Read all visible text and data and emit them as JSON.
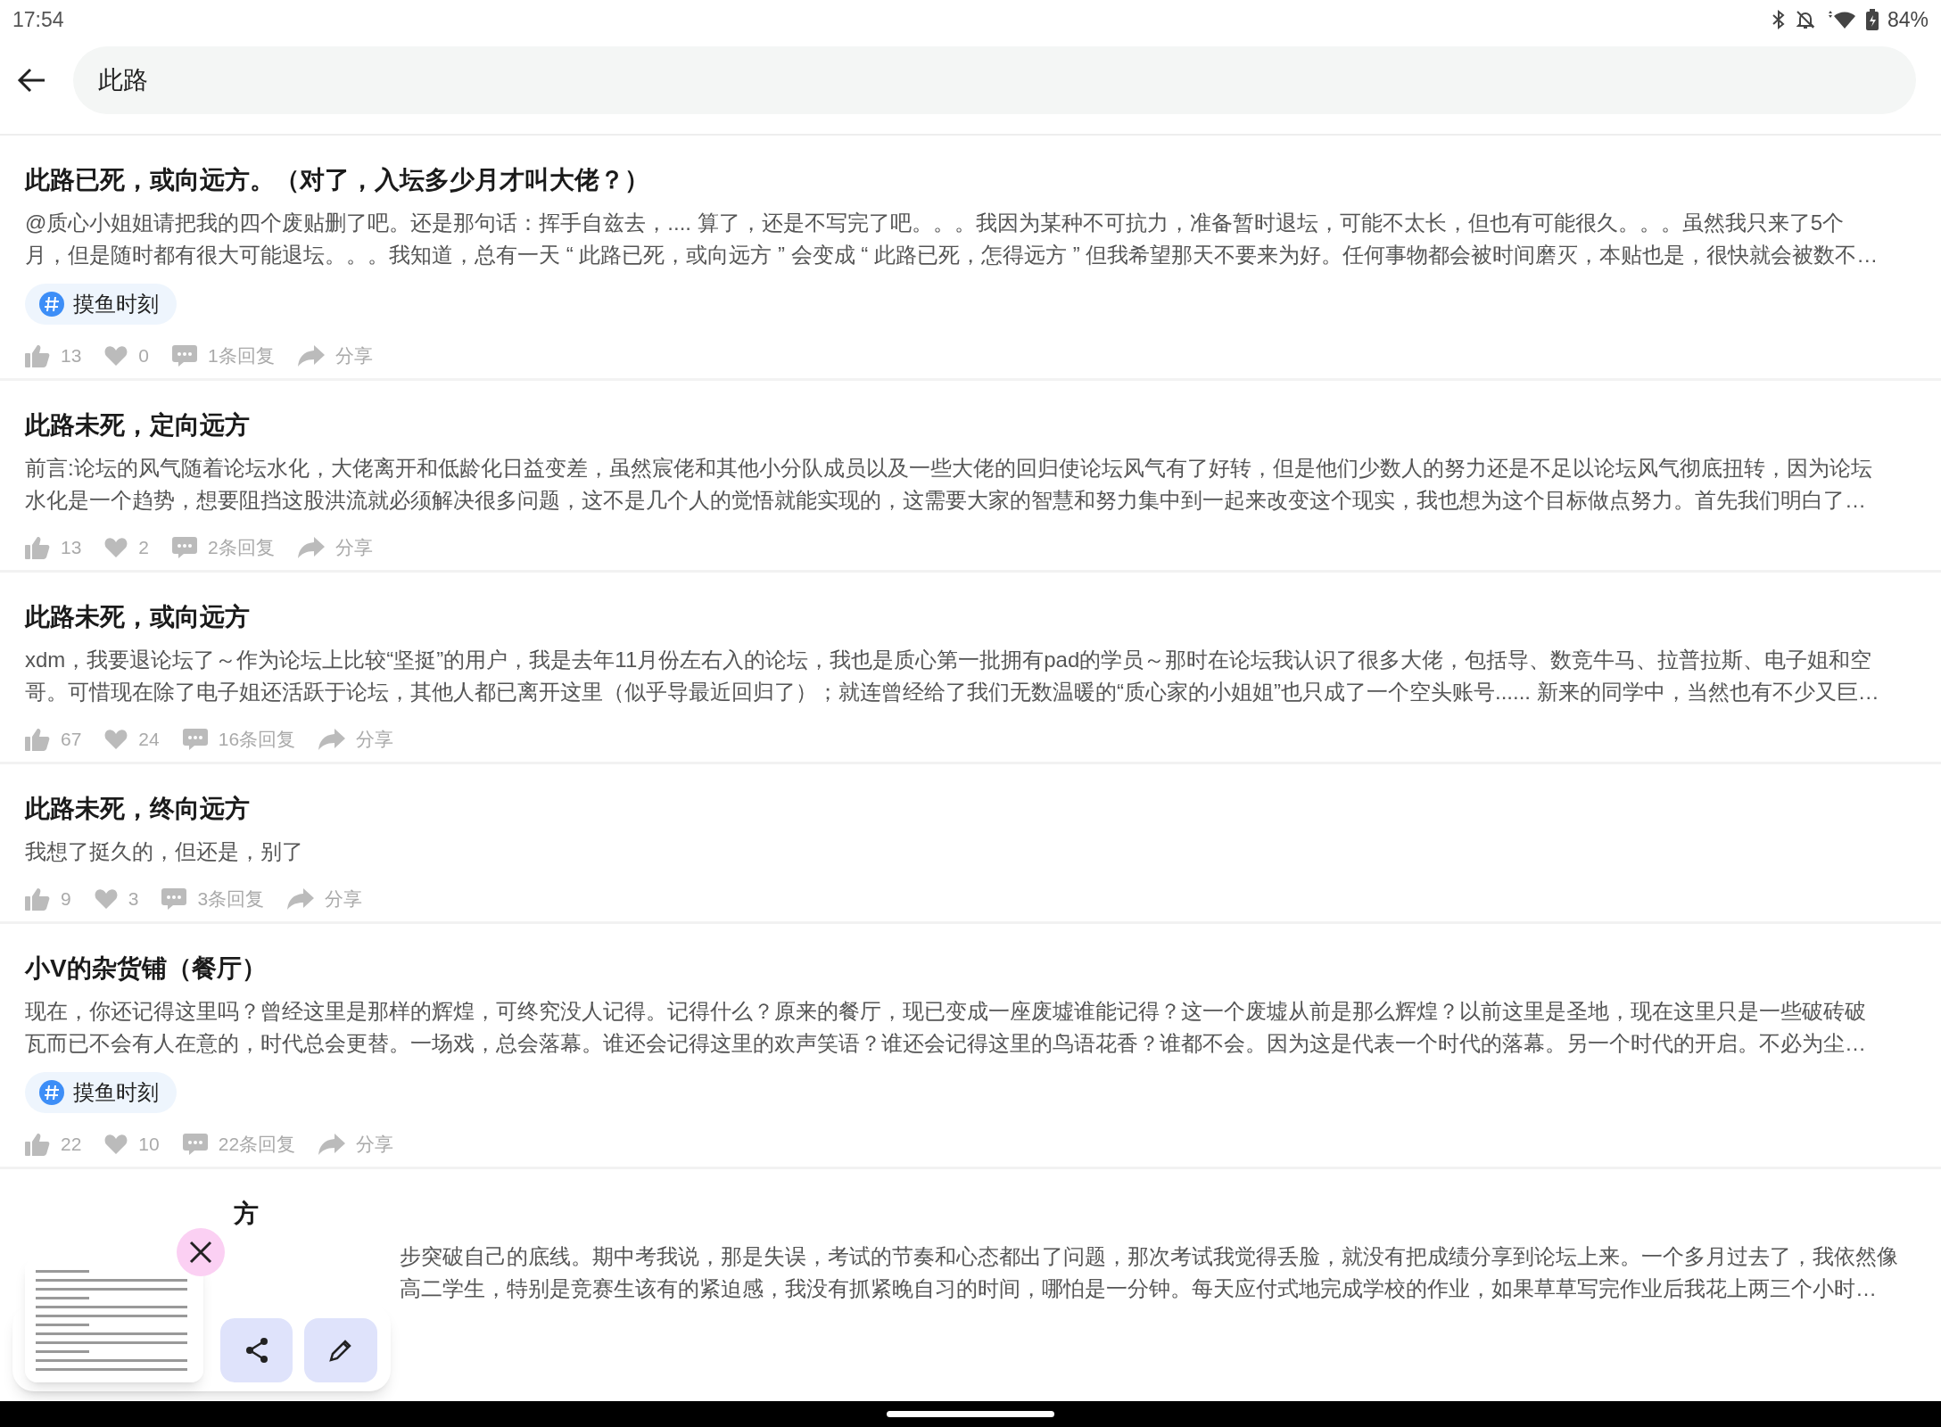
{
  "status_bar": {
    "time": "17:54",
    "battery": "84%"
  },
  "search": {
    "value": "此路"
  },
  "posts": [
    {
      "title": "此路已死，或向远方。（对了，入坛多少月才叫大佬？）",
      "lines": [
        "@质心小姐姐请把我的四个废贴删了吧。还是那句话：挥手自兹去，....  算了，还是不写完了吧。。。我因为某种不可抗力，准备暂时退坛，可能不太长，但也有可能很久。。。虽然我只来了5个",
        "月，但是随时都有很大可能退坛。。。我知道，总有一天 “ 此路已死，或向远方 ” 会变成 “ 此路已死，怎得远方 ” 但我希望那天不要来为好。任何事物都会被时间磨灭，本贴也是，很快就会被数不…"
      ],
      "tag": "摸鱼时刻",
      "likes": "13",
      "hearts": "0",
      "replies": "1条回复",
      "share": "分享"
    },
    {
      "title": "此路未死，定向远方",
      "lines": [
        "前言:论坛的风气随着论坛水化，大佬离开和低龄化日益变差，虽然宸佬和其他小分队成员以及一些大佬的回归使论坛风气有了好转，但是他们少数人的努力还是不足以论坛风气彻底扭转，因为论坛",
        "水化是一个趋势，想要阻挡这股洪流就必须解决很多问题，这不是几个人的觉悟就能实现的，这需要大家的智慧和努力集中到一起来改变这个现实，我也想为这个目标做点努力。首先我们明白了…"
      ],
      "likes": "13",
      "hearts": "2",
      "replies": "2条回复",
      "share": "分享"
    },
    {
      "title": "此路未死，或向远方",
      "lines": [
        "xdm，我要退论坛了～作为论坛上比较“坚挺”的用户，我是去年11月份左右入的论坛，我也是质心第一批拥有pad的学员～那时在论坛我认识了很多大佬，包括导、数竞牛马、拉普拉斯、电子姐和空",
        "哥。可惜现在除了电子姐还活跃于论坛，其他人都已离开这里（似乎导最近回归了）；就连曾经给了我们无数温暖的“质心家的小姐姐”也只成了一个空头账号...... 新来的同学中，当然也有不少又巨…"
      ],
      "likes": "67",
      "hearts": "24",
      "replies": "16条回复",
      "share": "分享"
    },
    {
      "title": "此路未死，终向远方",
      "lines": [
        "我想了挺久的，但还是，别了"
      ],
      "likes": "9",
      "hearts": "3",
      "replies": "3条回复",
      "share": "分享"
    },
    {
      "title": "小V的杂货铺（餐厅）",
      "lines": [
        "现在，你还记得这里吗？曾经这里是那样的辉煌，可终究没人记得。记得什么？原来的餐厅，现已变成一座废墟谁能记得？这一个废墟从前是那么辉煌？以前这里是圣地，现在这里只是一些破砖破",
        "瓦而已不会有人在意的，时代总会更替。一场戏，总会落幕。谁还会记得这里的欢声笑语？谁还会记得这里的鸟语花香？谁都不会。因为这是代表一个时代的落幕。另一个时代的开启。不必为尘…"
      ],
      "tag": "摸鱼时刻",
      "likes": "22",
      "hearts": "10",
      "replies": "22条回复",
      "share": "分享"
    }
  ],
  "partial_post": {
    "title": "方",
    "lines": [
      "步突破自己的底线。期中考我说，那是失误，考试的节奏和心态都出了问题，那次考试我觉得丢脸，就没有把成绩分享到论坛上来。一个多月过去了，我依然像",
      "高二学生，特别是竞赛生该有的紧迫感，我没有抓紧晚自习的时间，哪怕是一分钟。每天应付式地完成学校的作业，如果草草写完作业后我花上两三个小时…"
    ]
  }
}
